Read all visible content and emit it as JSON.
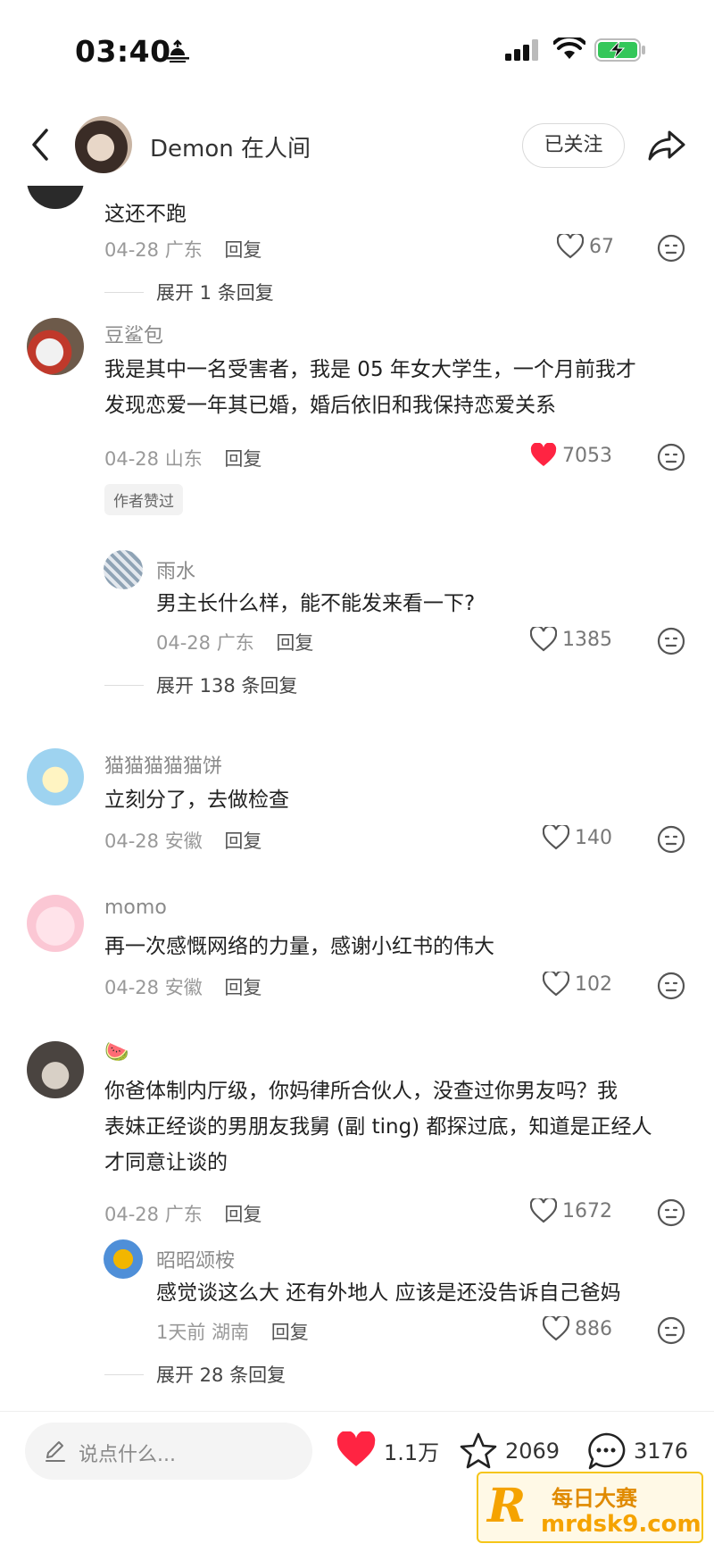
{
  "status_bar": {
    "time": "03:40"
  },
  "header": {
    "author_name": "Demon 在人间",
    "follow_label": "已关注"
  },
  "comments": [
    {
      "text": "这还不跑",
      "date": "04-28",
      "location": "广东",
      "reply": "回复",
      "likes": "67",
      "expand": "展开 1 条回复"
    },
    {
      "user": "豆鲨包",
      "text1": "我是其中一名受害者，我是 05 年女大学生，一个月前我才",
      "text2": "发现恋爱一年其已婚，婚后依旧和我保持恋爱关系",
      "date": "04-28",
      "location": "山东",
      "reply": "回复",
      "likes": "7053",
      "liked": true,
      "badge": "作者赞过",
      "sub": {
        "user": "雨水",
        "text": "男主长什么样，能不能发来看一下?",
        "date": "04-28",
        "location": "广东",
        "reply": "回复",
        "likes": "1385"
      },
      "expand": "展开 138 条回复"
    },
    {
      "user": "猫猫猫猫猫饼",
      "text": "立刻分了，去做检查",
      "date": "04-28",
      "location": "安徽",
      "reply": "回复",
      "likes": "140"
    },
    {
      "user": "momo",
      "text": "再一次感慨网络的力量，感谢小红书的伟大",
      "date": "04-28",
      "location": "安徽",
      "reply": "回复",
      "likes": "102"
    },
    {
      "user": "🍉",
      "text1": "你爸体制内厅级，你妈律所合伙人，没查过你男友吗？我",
      "text2": "表妹正经谈的男朋友我舅 (副 ting) 都探过底，知道是正经人",
      "text3": "才同意让谈的",
      "date": "04-28",
      "location": "广东",
      "reply": "回复",
      "likes": "1672",
      "sub": {
        "user": "昭昭颂桉",
        "text": "感觉谈这么大 还有外地人 应该是还没告诉自己爸妈",
        "date": "1天前",
        "location": "湖南",
        "reply": "回复",
        "likes": "886"
      },
      "expand": "展开 28 条回复"
    }
  ],
  "bottom_bar": {
    "placeholder": "说点什么...",
    "likes": "1.1万",
    "favorites": "2069",
    "comments": "3176"
  },
  "watermark": {
    "title": "每日大赛",
    "url": "mrdsk9.com",
    "logo_letter": "R"
  },
  "colors": {
    "like_red": "#ff2442",
    "text": "#222222",
    "muted": "#999999"
  }
}
